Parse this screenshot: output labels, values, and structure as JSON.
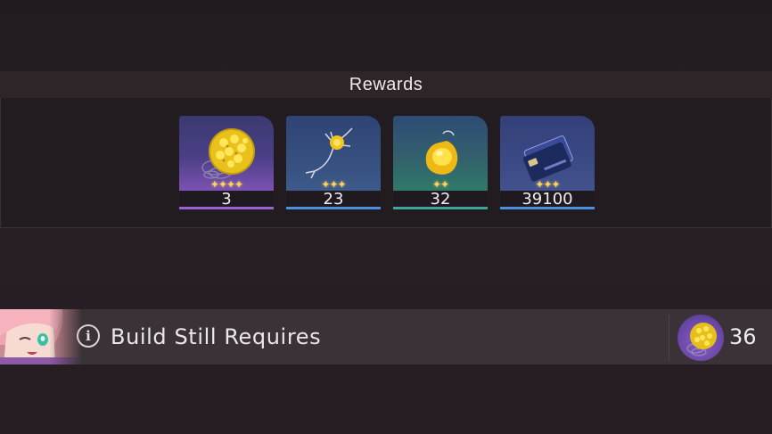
{
  "rewards": {
    "title": "Rewards",
    "items": [
      {
        "icon": "golden-coral-sphere-icon",
        "count": "3",
        "rarity_stars": 4,
        "stars_text": "✦✦✦✦",
        "bar_color": "#9b62d8"
      },
      {
        "icon": "golden-neuron-icon",
        "count": "23",
        "rarity_stars": 3,
        "stars_text": "✦✦✦",
        "bar_color": "#4c8fe0"
      },
      {
        "icon": "golden-amber-drop-icon",
        "count": "32",
        "rarity_stars": 2,
        "stars_text": "✦✦",
        "bar_color": "#3fa49a"
      },
      {
        "icon": "credit-card-icon",
        "count": "39100",
        "rarity_stars": 3,
        "stars_text": "✦✦✦",
        "bar_color": "#4c8fe0"
      }
    ]
  },
  "requires": {
    "label": "Build Still Requires",
    "info_icon": "i",
    "item_icon": "golden-coral-sphere-icon",
    "count": "36"
  }
}
